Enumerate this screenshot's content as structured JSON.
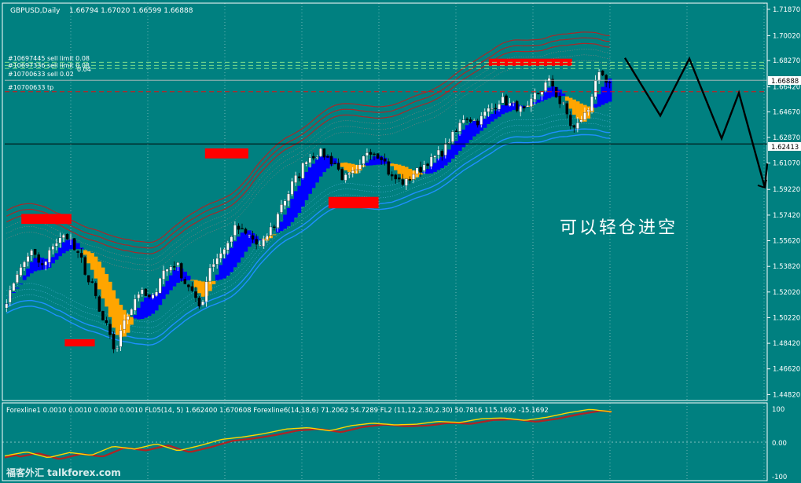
{
  "colors": {
    "background": "#008080",
    "bull_candle": "#ffffff",
    "bear_candle": "#000000",
    "ribbon_up": "#0000ff",
    "ribbon_down": "#ffa500",
    "band_upper": "#a52a2a",
    "band_lower": "#1e90ff",
    "zone": "#ff0000",
    "order_line": "#90ee90",
    "price_line": "#000000",
    "osc_fast": "#ffd700",
    "osc_slow": "#b22222"
  },
  "header": {
    "symbol": "GBPUSD,Daily",
    "ohlc": "1.66794 1.67020 1.66599 1.66888"
  },
  "orders": [
    "#10697445 sell limit 0.08",
    "#10697336 sell limit 0.08",
    "#10700633 sell 0.02",
    "#10700633 tp"
  ],
  "orders_overlap_fragment": "0.04",
  "current_price_tag": "1.66888",
  "hline_price_tag": "1.62413",
  "annotation": "可以轻仓进空",
  "indicator_header": "Forexline1 0.0010 0.0010 0.0010 0.0010   FL05(14, 5) 1.662400 1.670608   Forexline6(14,18,6) 71.2062 54.7289   FL2 (11,12,2.30,2.30) 50.7816 115.1692 -15.1692",
  "watermark": "福客外汇 talkforex.com",
  "chart_data": [
    {
      "type": "candlestick",
      "title": "GBPUSD,Daily",
      "price_axis": {
        "ticks": [
          "1.71870",
          "1.70020",
          "1.68270",
          "1.66420",
          "1.64670",
          "1.62870",
          "1.61070",
          "1.59220",
          "1.57420",
          "1.55620",
          "1.53820",
          "1.52020",
          "1.50220",
          "1.48420",
          "1.46620",
          "1.44820"
        ],
        "ylim": [
          1.444,
          1.723
        ]
      },
      "ohlc_header": {
        "open": 1.66794,
        "high": 1.6702,
        "low": 1.66599,
        "close": 1.66888
      },
      "anchor_closes": [
        1.515,
        1.535,
        1.548,
        1.538,
        1.555,
        1.56,
        1.545,
        1.525,
        1.5,
        1.48,
        1.505,
        1.52,
        1.515,
        1.535,
        1.54,
        1.525,
        1.51,
        1.54,
        1.55,
        1.565,
        1.56,
        1.552,
        1.565,
        1.585,
        1.6,
        1.615,
        1.618,
        1.612,
        1.6,
        1.604,
        1.62,
        1.616,
        1.6,
        1.597,
        1.605,
        1.612,
        1.618,
        1.63,
        1.643,
        1.64,
        1.648,
        1.655,
        1.651,
        1.647,
        1.66,
        1.668,
        1.652,
        1.635,
        1.645,
        1.672,
        1.665
      ],
      "horizontal_lines": [
        {
          "name": "sell limit 0.08",
          "price": 1.6815,
          "style": "dashed"
        },
        {
          "name": "sell limit 0.08",
          "price": 1.6793,
          "style": "dashed"
        },
        {
          "name": "sell 0.02",
          "price": 1.6771,
          "style": "dashed"
        },
        {
          "name": "tp",
          "price": 1.6608,
          "style": "dashed"
        },
        {
          "name": "current price",
          "price": 1.66888,
          "style": "solid"
        },
        {
          "name": "level",
          "price": 1.62413,
          "style": "solid"
        }
      ],
      "zones": [
        {
          "bar_from": 0.05,
          "bar_to": 0.2,
          "price_from": 1.568,
          "price_to": 1.575
        },
        {
          "bar_from": 0.18,
          "bar_to": 0.27,
          "price_from": 1.482,
          "price_to": 1.487
        },
        {
          "bar_from": 0.6,
          "bar_to": 0.73,
          "price_from": 1.614,
          "price_to": 1.621
        },
        {
          "bar_from": 0.97,
          "bar_to": 1.12,
          "price_from": 1.579,
          "price_to": 1.587
        },
        {
          "bar_from": 1.45,
          "bar_to": 1.7,
          "price_from": 1.679,
          "price_to": 1.684
        }
      ],
      "forecast_path": [
        1.6845,
        1.644,
        1.684,
        1.628,
        1.66,
        1.5935,
        1.6105
      ],
      "grid": false
    },
    {
      "type": "line",
      "name": "oscillator",
      "ylim": [
        -100,
        100
      ],
      "ticks": [
        "100",
        "0.00",
        "-100"
      ],
      "anchor_values_fast": [
        -40,
        -28,
        -45,
        -30,
        -38,
        -12,
        -20,
        -5,
        -25,
        -10,
        8,
        15,
        25,
        38,
        42,
        33,
        48,
        55,
        50,
        52,
        60,
        57,
        68,
        70,
        63,
        72,
        85,
        95,
        88
      ]
    }
  ]
}
